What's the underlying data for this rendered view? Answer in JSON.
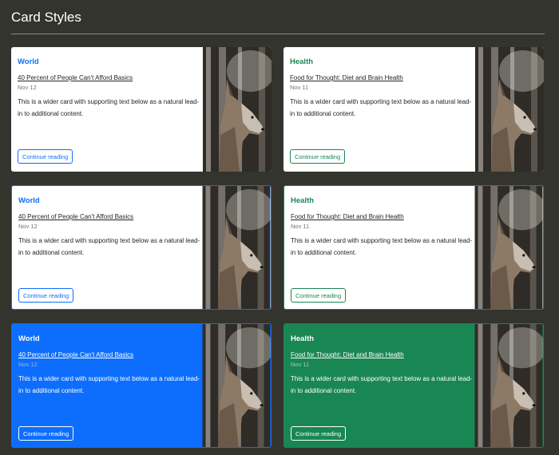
{
  "page": {
    "title": "Card Styles"
  },
  "cards": [
    {
      "category": "World",
      "headline": "40 Percent of People Can't Afford Basics",
      "date": "Nov 12",
      "text": "This is a wider card with supporting text below as a natural lead-in to additional content.",
      "button": "Continue reading"
    },
    {
      "category": "Health",
      "headline": "Food for Thought: Diet and Brain Health",
      "date": "Nov 11",
      "text": "This is a wider card with supporting text below as a natural lead-in to additional content.",
      "button": "Continue reading"
    },
    {
      "category": "World",
      "headline": "40 Percent of People Can't Afford Basics",
      "date": "Nov 12",
      "text": "This is a wider card with supporting text below as a natural lead-in to additional content.",
      "button": "Continue reading"
    },
    {
      "category": "Health",
      "headline": "Food for Thought: Diet and Brain Health",
      "date": "Nov 11",
      "text": "This is a wider card with supporting text below as a natural lead-in to additional content.",
      "button": "Continue reading"
    },
    {
      "category": "World",
      "headline": "40 Percent of People Can't Afford Basics",
      "date": "Nov 12",
      "text": "This is a wider card with supporting text below as a natural lead-in to additional content.",
      "button": "Continue reading"
    },
    {
      "category": "Health",
      "headline": "Food for Thought: Diet and Brain Health",
      "date": "Nov 11",
      "text": "This is a wider card with supporting text below as a natural lead-in to additional content.",
      "button": "Continue reading"
    }
  ],
  "colors": {
    "primary": "#0d6efd",
    "success": "#198754",
    "background": "#34342e"
  }
}
